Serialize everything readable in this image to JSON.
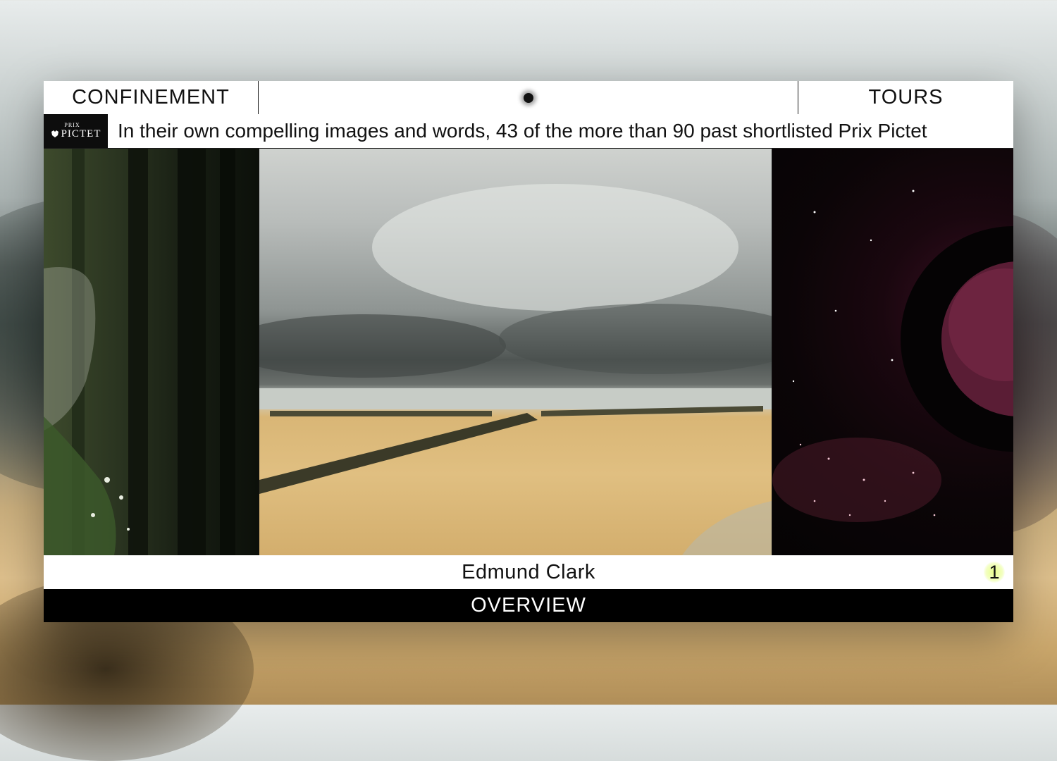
{
  "header": {
    "left_label": "CONFINEMENT",
    "right_label": "TOURS"
  },
  "ticker": {
    "logo_small": "PRIX",
    "logo_big": "PICTET",
    "text": "In their own compelling images and words, 43 of the more than 90 past shortlisted Prix Pictet"
  },
  "gallery": {
    "photos": [
      {
        "name": "forest-spiderweb"
      },
      {
        "name": "beach-groynes"
      },
      {
        "name": "space-planet"
      }
    ]
  },
  "caption": {
    "photographer": "Edmund Clark",
    "counter": "1"
  },
  "footer": {
    "overview_label": "OVERVIEW"
  },
  "colors": {
    "accent_highlight": "#e9ff8a",
    "bar_black": "#000000"
  }
}
